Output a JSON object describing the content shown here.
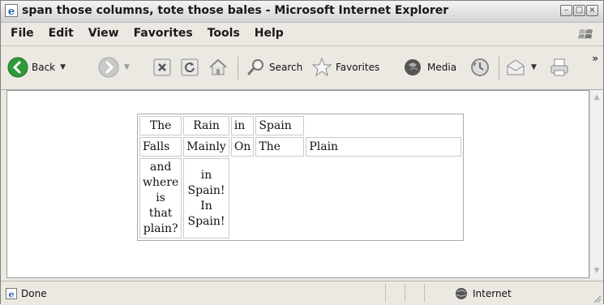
{
  "window": {
    "title": "span those columns, tote those bales - Microsoft Internet Explorer"
  },
  "menubar": {
    "items": [
      "File",
      "Edit",
      "View",
      "Favorites",
      "Tools",
      "Help"
    ]
  },
  "toolbar": {
    "back_label": "Back",
    "search_label": "Search",
    "favorites_label": "Favorites",
    "media_label": "Media",
    "overflow": "»"
  },
  "table": {
    "row1": [
      "The",
      "Rain",
      "in",
      "Spain"
    ],
    "row2": [
      "Falls",
      "Mainly",
      "On",
      "The",
      "Plain"
    ],
    "row3": [
      "and where is that plain?",
      "in Spain! In Spain!"
    ]
  },
  "status": {
    "text": "Done",
    "zone": "Internet"
  },
  "colors": {
    "back_green": "#2f9a3a",
    "ie_blue": "#2e63b8"
  }
}
